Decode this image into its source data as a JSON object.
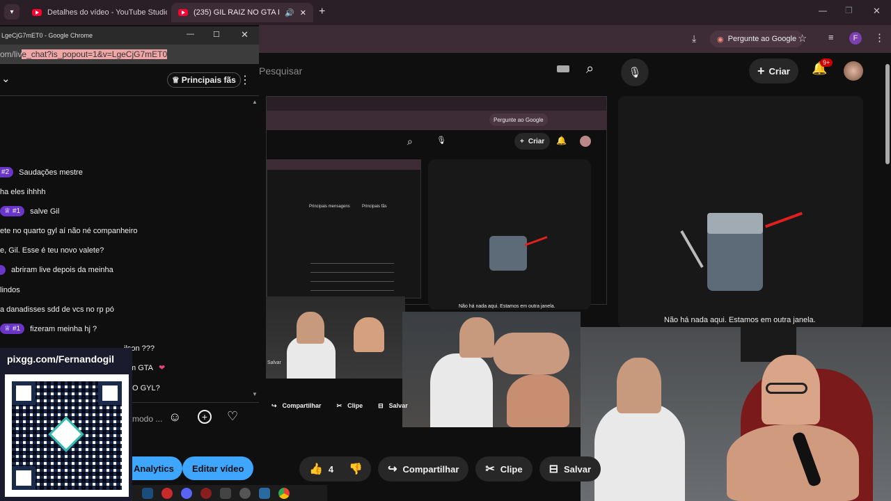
{
  "tabs": [
    {
      "label": "Detalhes do vídeo - YouTube Studio"
    },
    {
      "label": "(235) GIL RAIZ NO GTA RP! - YouTube"
    }
  ],
  "toolbar": {
    "ask_google": "Pergunte ao Google",
    "profile_letter": "F"
  },
  "yt_header": {
    "search_placeholder": "Pesquisar",
    "create_label": "Criar",
    "notifications": "9+"
  },
  "popup": {
    "title": "LgeCjG7mET0 - Google Chrome",
    "url_prefix": "om/liv",
    "url_highlight": "e_chat?is_popout=1&v=LgeCjG7mET0",
    "top_fans": "Principais fãs",
    "chat_placeholder": "modo ...",
    "messages": [
      {
        "badge": "#2",
        "text": "Saudações mestre"
      },
      {
        "badge": "",
        "text": "ha eles ihhhh"
      },
      {
        "badge": "#1",
        "text": "salve Gil"
      },
      {
        "badge": "",
        "text": "ete no quarto gyl aí não né companheiro"
      },
      {
        "badge": "",
        "text": "e, Gil. Esse é teu novo valete?"
      },
      {
        "badge": "",
        "text": "abriram live depois da meinha"
      },
      {
        "badge": "",
        "text": "lindos"
      },
      {
        "badge": "",
        "text": "a danadisses sdd de vcs no rp pó"
      },
      {
        "badge": "#1",
        "text": "fizeram meinha hj ?"
      },
      {
        "badge": "",
        "text": "ilson ???"
      },
      {
        "badge": "",
        "text": "m GTA"
      },
      {
        "badge": "",
        "text": "O GYL?"
      }
    ]
  },
  "pix": {
    "handle": "pixgg.com/Fernandogil"
  },
  "studio_buttons": {
    "analytics": "Analytics",
    "edit_video": "Editar vídeo"
  },
  "actions": {
    "likes": "4",
    "share": "Compartilhar",
    "clip": "Clipe",
    "save": "Salvar"
  },
  "nested": {
    "share": "Compartilhar",
    "clip": "Clipe",
    "save": "Salvar",
    "create_label": "Criar",
    "ask_google": "Pergunte ao Google",
    "top_messages": "Principais mensagens",
    "top_fans_small": "Principais fãs",
    "mini_save": "Salvar"
  },
  "empty_message": "Não há nada aqui. Estamos em outra janela.",
  "colors": {
    "accent_blue": "#3ea6ff",
    "badge_purple": "#6a35c9",
    "tab_bg": "#2a1f26"
  }
}
